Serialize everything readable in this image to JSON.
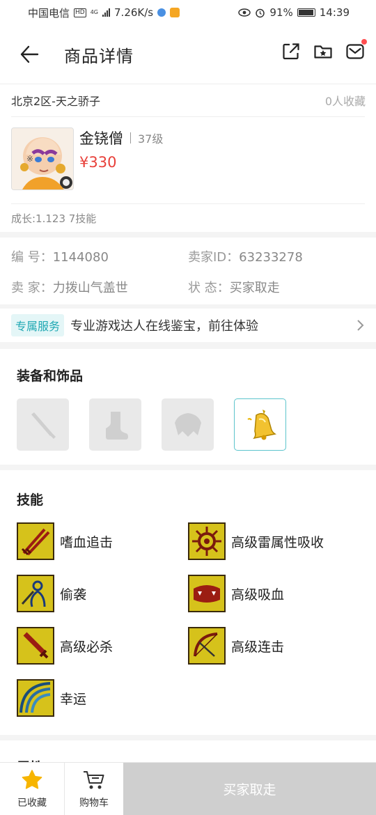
{
  "status_bar": {
    "carrier": "中国电信",
    "network_hd": "HD",
    "network_type": "4G",
    "speed": "7.26K/s",
    "battery": "91%",
    "time": "14:39"
  },
  "nav": {
    "title": "商品详情",
    "back_icon": "arrow-left-icon",
    "actions": [
      "share-icon",
      "folder-star-icon",
      "mail-icon"
    ],
    "mail_badge_color": "#ff4d4f"
  },
  "listing": {
    "server": "北京2区-天之骄子",
    "fav_count": "0人收藏",
    "name": "金铙僧",
    "level": "37级",
    "price": "¥330",
    "growth": "成长:1.123 7技能"
  },
  "info": {
    "id_label": "编  号：",
    "id_value": "1144080",
    "seller_id_label": "卖家ID：",
    "seller_id_value": "63233278",
    "seller_label": "卖  家：",
    "seller_value": "力拨山气盖世",
    "status_label": "状  态：",
    "status_value": "买家取走"
  },
  "service": {
    "tag": "专属服务",
    "text": "专业游戏达人在线鉴宝，前往体验"
  },
  "equipment": {
    "title": "装备和饰品",
    "slots": [
      {
        "type": "weapon",
        "filled": false
      },
      {
        "type": "boots",
        "filled": false
      },
      {
        "type": "armor",
        "filled": false
      },
      {
        "type": "accessory-bell",
        "filled": true
      }
    ]
  },
  "skills": {
    "title": "技能",
    "items": [
      {
        "name": "嗜血追击",
        "icon": "swords-icon"
      },
      {
        "name": "高级雷属性吸收",
        "icon": "thunder-wheel-icon"
      },
      {
        "name": "偷袭",
        "icon": "sneak-icon"
      },
      {
        "name": "高级吸血",
        "icon": "vampire-mouth-icon"
      },
      {
        "name": "高级必杀",
        "icon": "sword-icon"
      },
      {
        "name": "高级连击",
        "icon": "bow-icon"
      },
      {
        "name": "幸运",
        "icon": "rainbow-icon"
      }
    ]
  },
  "attributes": {
    "title": "属性"
  },
  "bottom_bar": {
    "favorite_label": "已收藏",
    "cart_label": "购物车",
    "buy_label": "买家取走",
    "favorite_color": "#f7b500",
    "buy_bg": "#cfcfcf"
  }
}
